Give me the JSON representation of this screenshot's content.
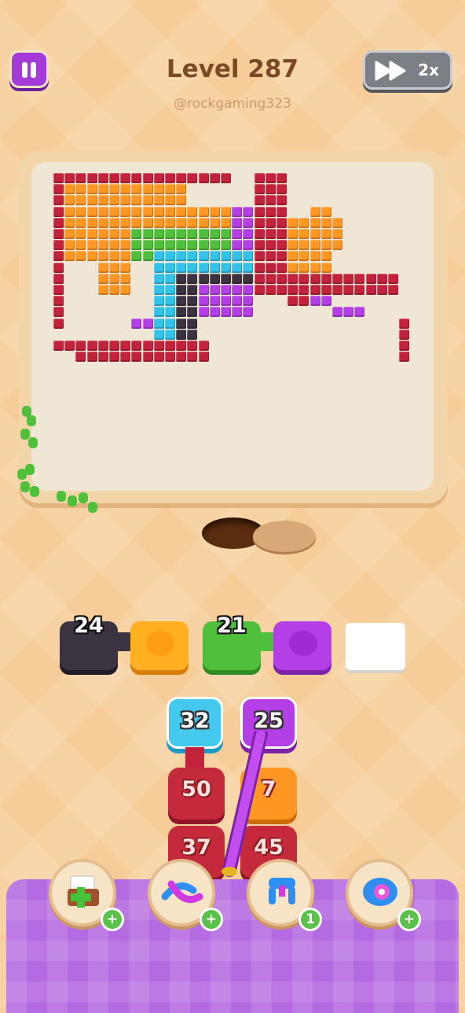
{
  "header": {
    "level_title": "Level 287",
    "username": "@rockgaming323",
    "speed_label": "2x"
  },
  "colors": {
    "red": "#c2223a",
    "orange": "#ff9722",
    "green": "#4fbf3c",
    "purple": "#b53fe6",
    "cyan": "#33c3ea",
    "dark": "#3b3340",
    "board": "#f0e6d6",
    "panel": "#b46ae0"
  },
  "shooters": [
    {
      "count": "24",
      "color": "dark"
    },
    {
      "count": "",
      "color": "orange"
    },
    {
      "count": "21",
      "color": "green"
    },
    {
      "count": "",
      "color": "purple"
    },
    {
      "count": "",
      "color": "empty"
    }
  ],
  "queue": {
    "column_1": [
      "32",
      "50",
      "37"
    ],
    "column_2": [
      "25",
      "7",
      "45"
    ]
  },
  "boosters": [
    {
      "icon": "add-box-icon",
      "badge": "+"
    },
    {
      "icon": "swap-arrows-icon",
      "badge": "+"
    },
    {
      "icon": "magnet-claw-icon",
      "badge": "1"
    },
    {
      "icon": "spool-icon",
      "badge": "+"
    }
  ]
}
